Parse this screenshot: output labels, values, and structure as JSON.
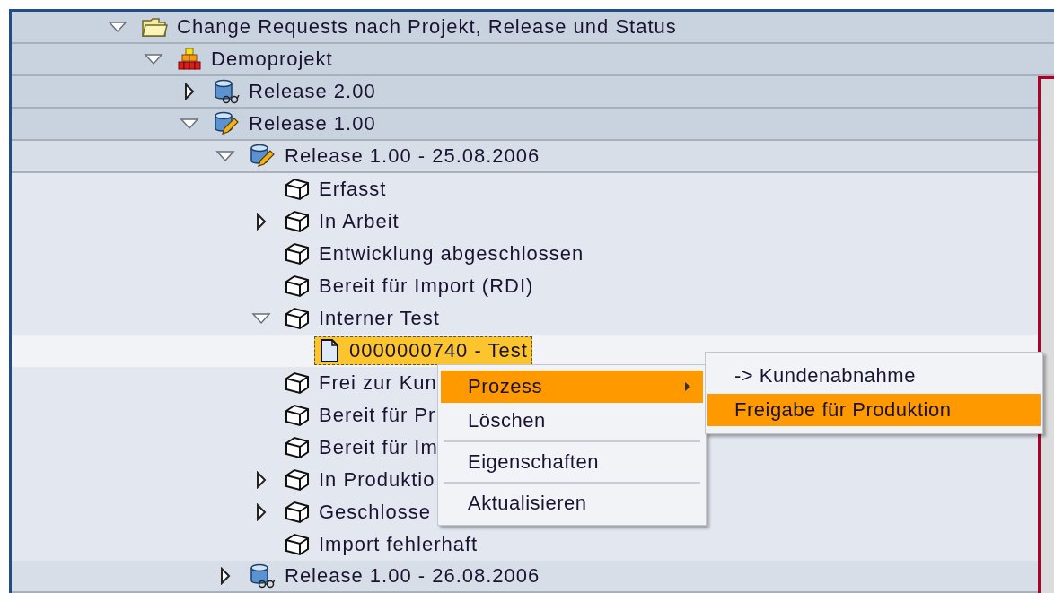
{
  "tree": [
    {
      "label": "Change Requests nach Projekt, Release und Status",
      "kind": "folder",
      "expanded": true,
      "selected": false,
      "children": [
        {
          "label": "Demoprojekt",
          "kind": "project",
          "expanded": true,
          "selected": false,
          "children": [
            {
              "label": "Release 2.00",
              "kind": "release-glasses",
              "expanded": false,
              "selected": false
            },
            {
              "label": "Release 1.00",
              "kind": "release-pencil",
              "expanded": true,
              "selected": false,
              "children": [
                {
                  "label": "Release 1.00 - 25.08.2006",
                  "kind": "release-pencil",
                  "expanded": true,
                  "selected": false,
                  "children": [
                    {
                      "label": "Erfasst",
                      "kind": "status",
                      "selected": false
                    },
                    {
                      "label": "In Arbeit",
                      "kind": "status",
                      "expanded": false,
                      "selected": false
                    },
                    {
                      "label": "Entwicklung abgeschlossen",
                      "kind": "status",
                      "selected": false
                    },
                    {
                      "label": "Bereit für Import (RDI)",
                      "kind": "status",
                      "selected": false
                    },
                    {
                      "label": "Interner Test",
                      "kind": "status",
                      "expanded": true,
                      "selected": false,
                      "children": [
                        {
                          "label": "0000000740 - Test",
                          "kind": "document",
                          "selected": true
                        }
                      ]
                    },
                    {
                      "label": "Frei zur Kun",
                      "kind": "status",
                      "selected": false
                    },
                    {
                      "label": "Bereit für Pr",
                      "kind": "status",
                      "selected": false
                    },
                    {
                      "label": "Bereit für Im",
                      "kind": "status",
                      "selected": false
                    },
                    {
                      "label": "In Produktio",
                      "kind": "status",
                      "expanded": false,
                      "selected": false
                    },
                    {
                      "label": "Geschlosse",
                      "kind": "status",
                      "expanded": false,
                      "selected": false
                    },
                    {
                      "label": "Import fehlerhaft",
                      "kind": "status",
                      "selected": false
                    }
                  ]
                },
                {
                  "label": "Release 1.00 - 26.08.2006",
                  "kind": "release-glasses",
                  "expanded": false,
                  "selected": false
                }
              ]
            }
          ]
        }
      ]
    }
  ],
  "context_menu": {
    "items": [
      {
        "label": "Prozess",
        "submenu": true,
        "selected": true
      },
      {
        "label": "Löschen",
        "selected": false,
        "separator_after": true
      },
      {
        "label": "Eigenschaften",
        "selected": false,
        "separator_after": true
      },
      {
        "label": "Aktualisieren",
        "selected": false
      }
    ]
  },
  "submenu": {
    "items": [
      {
        "label": "-> Kundenabnahme",
        "selected": false
      },
      {
        "label": "Freigabe für Produktion",
        "selected": true
      }
    ]
  }
}
